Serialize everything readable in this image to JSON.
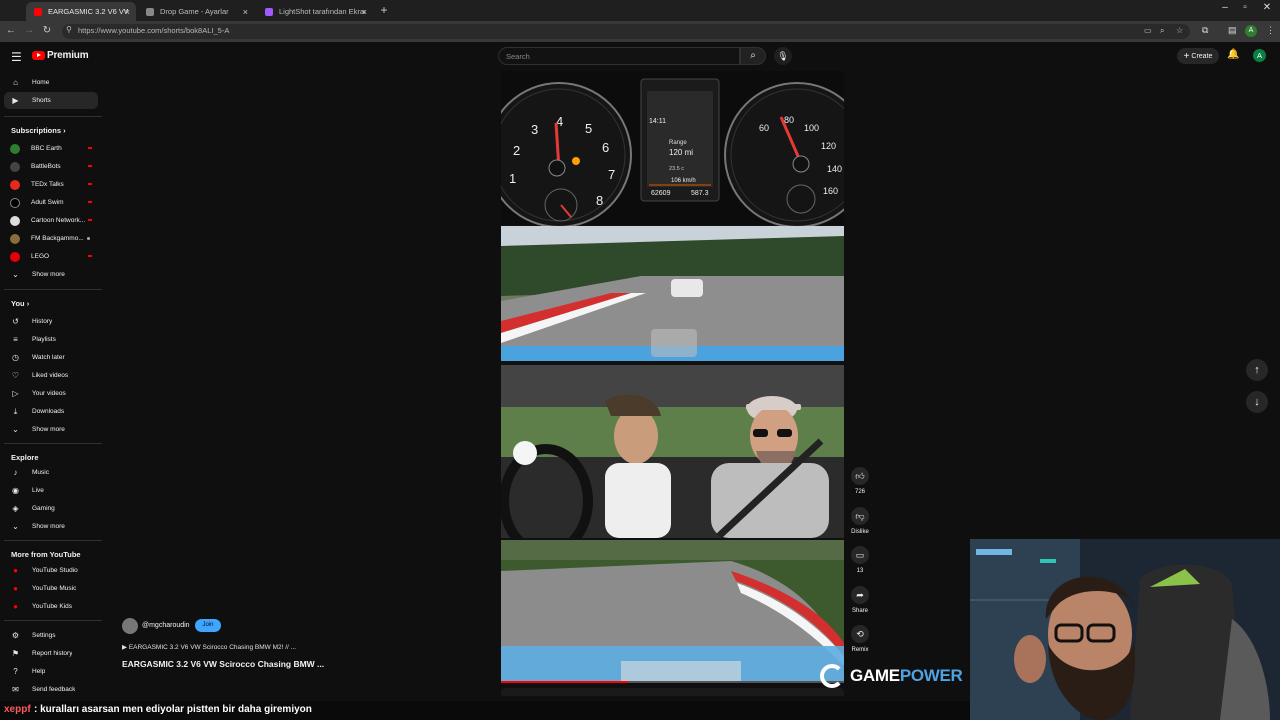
{
  "browser": {
    "tabs": [
      {
        "label": "EARGASMIC 3.2 V6 VW Sci",
        "active": true,
        "color": "#ff0000"
      },
      {
        "label": "Drop Game - Ayarlar",
        "active": false,
        "color": "#888888"
      },
      {
        "label": "LightShot tarafından Ekran Gö",
        "active": false,
        "color": "#a259ff"
      }
    ],
    "url": "https://www.youtube.com/shorts/bok8ALI_5-A",
    "profile_initial": "A"
  },
  "header": {
    "logo_text": "Premium",
    "search_placeholder": "Search",
    "create_label": "Create",
    "avatar_initial": "A"
  },
  "sidebar": {
    "main": [
      {
        "label": "Home",
        "icon": "home-icon",
        "glyph": "⌂"
      },
      {
        "label": "Shorts",
        "icon": "shorts-icon",
        "glyph": "▶",
        "active": true
      }
    ],
    "subscriptions_heading": "Subscriptions",
    "subscriptions": [
      {
        "label": "BBC Earth",
        "color": "#2e7d32",
        "live": true
      },
      {
        "label": "BattleBots",
        "color": "#444444",
        "live": true
      },
      {
        "label": "TEDx Talks",
        "color": "#e62b1e",
        "live": true
      },
      {
        "label": "Adult Swim",
        "color": "#000000",
        "live": true
      },
      {
        "label": "Cartoon Network...",
        "color": "#dddddd",
        "live": true
      },
      {
        "label": "FM Backgammo...",
        "color": "#8a6d3b",
        "dot": true
      },
      {
        "label": "LEGO",
        "color": "#e3000b",
        "live": true
      }
    ],
    "subs_show_more": "Show more",
    "you_heading": "You",
    "you": [
      {
        "label": "History",
        "glyph": "↺"
      },
      {
        "label": "Playlists",
        "glyph": "≡"
      },
      {
        "label": "Watch later",
        "glyph": "◷"
      },
      {
        "label": "Liked videos",
        "glyph": "👍"
      },
      {
        "label": "Your videos",
        "glyph": "▷"
      },
      {
        "label": "Downloads",
        "glyph": "⤓"
      }
    ],
    "you_show_more": "Show more",
    "explore_heading": "Explore",
    "explore": [
      {
        "label": "Music",
        "glyph": "♪"
      },
      {
        "label": "Live",
        "glyph": "◉"
      },
      {
        "label": "Gaming",
        "glyph": "◈"
      }
    ],
    "explore_show_more": "Show more",
    "more_heading": "More from YouTube",
    "more": [
      {
        "label": "YouTube Studio",
        "color": "#ff0000"
      },
      {
        "label": "YouTube Music",
        "color": "#ff0000"
      },
      {
        "label": "YouTube Kids",
        "color": "#ff0000"
      }
    ],
    "footer": [
      {
        "label": "Settings",
        "glyph": "⚙"
      },
      {
        "label": "Report history",
        "glyph": "⚑"
      },
      {
        "label": "Help",
        "glyph": "?"
      },
      {
        "label": "Send feedback",
        "glyph": "✉"
      }
    ]
  },
  "short": {
    "channel": "@mgcharoudin",
    "join_label": "Join",
    "music_line": "EARGASMIC 3.2 V6 VW Scirocco Chasing BMW M2! // ...",
    "title": "EARGASMIC 3.2 V6 VW Scirocco Chasing BMW ...",
    "progress": 0.37,
    "dash": {
      "time": "14:11",
      "range_label": "Range",
      "range_value": "120 mi",
      "temp": "23.5 c",
      "speed": "106 km/h",
      "odometer": "62609",
      "trip": "587.3",
      "rpm_ticks": [
        "1",
        "2",
        "3",
        "4",
        "5",
        "6",
        "7",
        "8"
      ],
      "speed_ticks": [
        "60",
        "80",
        "100",
        "120",
        "140",
        "160",
        "180"
      ]
    }
  },
  "actions": {
    "like_count": "726",
    "dislike_label": "Dislike",
    "comment_count": "13",
    "share_label": "Share",
    "remix_label": "Remix"
  },
  "overlay": {
    "chat_user": "xeppf",
    "chat_message": ": kuralları asarsan men ediyolar pistten bir daha giremiyon",
    "brand_game": "GAME",
    "brand_power": "POWER"
  }
}
